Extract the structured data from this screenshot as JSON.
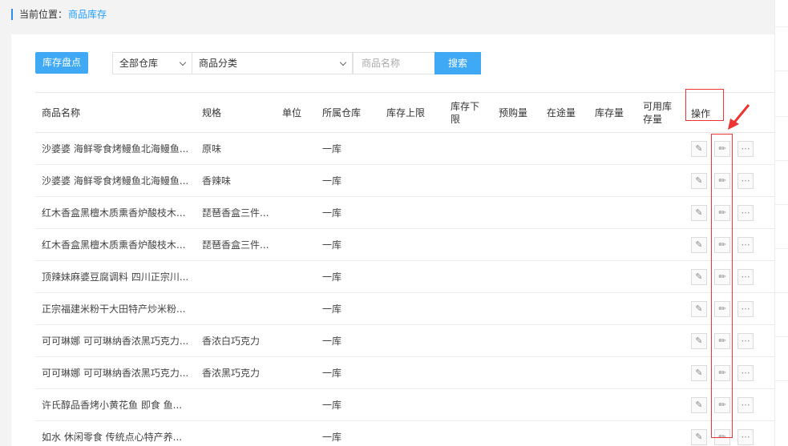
{
  "breadcrumb": {
    "label": "当前位置：",
    "current": "商品库存"
  },
  "toolbar": {
    "inventory_button": "库存盘点",
    "warehouse_select": "全部仓库",
    "category_select": "商品分类",
    "search_placeholder": "商品名称",
    "search_button": "搜索"
  },
  "table": {
    "headers": {
      "name": "商品名称",
      "spec": "规格",
      "unit": "单位",
      "warehouse": "所属仓库",
      "upper": "库存上限",
      "lower_1": "库存下",
      "lower_2": "限",
      "preorder": "预购量",
      "transit": "在途量",
      "stock": "库存量",
      "available_1": "可用库",
      "available_2": "存量",
      "actions": "操作"
    },
    "rows": [
      {
        "name": "沙婆婆 海鲜零食烤鳗鱼北海鳗鱼...",
        "spec": "原味",
        "warehouse": "一库"
      },
      {
        "name": "沙婆婆 海鲜零食烤鳗鱼北海鳗鱼...",
        "spec": "香辣味",
        "warehouse": "一库"
      },
      {
        "name": "红木香盒黑檀木质熏香炉酸枝木...",
        "spec": "琵琶香盒三件...",
        "warehouse": "一库"
      },
      {
        "name": "红木香盒黑檀木质熏香炉酸枝木...",
        "spec": "琵琶香盒三件...",
        "warehouse": "一库"
      },
      {
        "name": "顶辣妹麻婆豆腐调料 四川正宗川...",
        "spec": "",
        "warehouse": "一库"
      },
      {
        "name": "正宗福建米粉干大田特产炒米粉...",
        "spec": "",
        "warehouse": "一库"
      },
      {
        "name": "可可琳娜 可可琳纳香浓黑巧克力...",
        "spec": "香浓白巧克力",
        "warehouse": "一库"
      },
      {
        "name": "可可琳娜 可可琳纳香浓黑巧克力...",
        "spec": "香浓黑巧克力",
        "warehouse": "一库"
      },
      {
        "name": "许氏醇品香烤小黄花鱼 即食 鱼...",
        "spec": "",
        "warehouse": "一库"
      },
      {
        "name": "如水 休闲零食 传统点心特产养...",
        "spec": "",
        "warehouse": "一库"
      }
    ]
  },
  "colors": {
    "primary": "#3fa9f5",
    "link": "#1e9fff",
    "annotation": "#ee3333"
  }
}
